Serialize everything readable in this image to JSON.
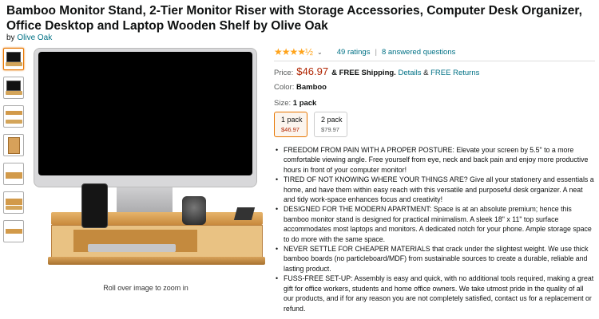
{
  "product": {
    "title": "Bamboo Monitor Stand, 2-Tier Monitor Riser with Storage Accessories, Computer Desk Organizer, Office Desktop and Laptop Wooden Shelf by Olive Oak",
    "by_prefix": "by",
    "brand": "Olive Oak"
  },
  "gallery": {
    "thumbnails": [
      "thumb-front-monitor",
      "thumb-monitor-desk",
      "thumb-stand-top",
      "thumb-box",
      "thumb-shelf-side",
      "thumb-stand-items",
      "thumb-stand-empty"
    ],
    "zoom_hint": "Roll over image to zoom in"
  },
  "rating": {
    "stars": "★★★★½",
    "stars_value": 4.5,
    "chevron": "⌄",
    "ratings_text": "49 ratings",
    "separator": "|",
    "answered_text": "8 answered questions"
  },
  "price": {
    "label": "Price:",
    "amount": "$46.97",
    "shipping_prefix": "& FREE Shipping.",
    "details_link": "Details",
    "amp": "&",
    "returns_link": "FREE Returns"
  },
  "color": {
    "label": "Color:",
    "value": "Bamboo"
  },
  "size": {
    "label": "Size:",
    "value": "1 pack",
    "options": [
      {
        "name": "1 pack",
        "price": "$46.97"
      },
      {
        "name": "2 pack",
        "price": "$79.97"
      }
    ]
  },
  "bullets": [
    "FREEDOM FROM PAIN WITH A PROPER POSTURE: Elevate your screen by 5.5\" to a more comfortable viewing angle. Free yourself from eye, neck and back pain and enjoy more productive hours in front of your computer monitor!",
    "TIRED OF NOT KNOWING WHERE YOUR THINGS ARE? Give all your stationery and essentials a home, and have them within easy reach with this versatile and purposeful desk organizer. A neat and tidy work-space enhances focus and creativity!",
    "DESIGNED FOR THE MODERN APARTMENT: Space is at an absolute premium; hence this bamboo monitor stand is designed for practical minimalism. A sleek 18\" x 11\" top surface accommodates most laptops and monitors. A dedicated notch for your phone. Ample storage space to do more with the same space.",
    "NEVER SETTLE FOR CHEAPER MATERIALS that crack under the slightest weight. We use thick bamboo boards (no particleboard/MDF) from sustainable sources to create a durable, reliable and lasting product.",
    "FUSS-FREE SET-UP: Assembly is easy and quick, with no additional tools required, making a great gift for office workers, students and home office owners. We take utmost pride in the quality of all our products, and if for any reason you are not completely satisfied, contact us for a replacement or refund."
  ],
  "colors": {
    "link": "#007185",
    "price": "#B12704",
    "star": "#FFA41C",
    "selected_border": "#E77600"
  }
}
